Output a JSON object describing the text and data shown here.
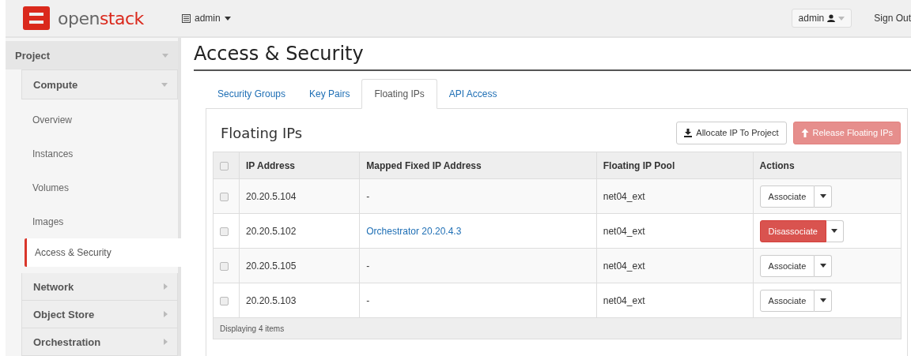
{
  "header": {
    "logo_parts": [
      "open",
      "stack"
    ],
    "project_menu": "admin",
    "user_menu": "admin",
    "sign_out": "Sign Out"
  },
  "sidebar": {
    "panel": {
      "label": "Project",
      "expanded": true
    },
    "groups": [
      {
        "label": "Compute",
        "expanded": true,
        "items": [
          {
            "label": "Overview",
            "selected": false
          },
          {
            "label": "Instances",
            "selected": false
          },
          {
            "label": "Volumes",
            "selected": false
          },
          {
            "label": "Images",
            "selected": false
          },
          {
            "label": "Access & Security",
            "selected": true
          }
        ]
      },
      {
        "label": "Network",
        "expanded": false
      },
      {
        "label": "Object Store",
        "expanded": false
      },
      {
        "label": "Orchestration",
        "expanded": false
      }
    ]
  },
  "page_title": "Access & Security",
  "tabs": [
    {
      "label": "Security Groups",
      "selected": false
    },
    {
      "label": "Key Pairs",
      "selected": false
    },
    {
      "label": "Floating IPs",
      "selected": true
    },
    {
      "label": "API Access",
      "selected": false
    }
  ],
  "table": {
    "title": "Floating IPs",
    "buttons": [
      {
        "label": "Allocate IP To Project",
        "kind": "default",
        "disabled": false
      },
      {
        "label": "Release Floating IPs",
        "kind": "danger",
        "disabled": true
      }
    ],
    "select_all": {
      "checked": false
    },
    "columns": [
      "IP Address",
      "Mapped Fixed IP Address",
      "Floating IP Pool",
      "Actions"
    ],
    "rows": [
      {
        "checked": false,
        "ip": "20.20.5.104",
        "mapped": {
          "text": "-",
          "link": false
        },
        "pool": "net04_ext",
        "action": {
          "label": "Associate",
          "kind": "default"
        }
      },
      {
        "checked": false,
        "ip": "20.20.5.102",
        "mapped": {
          "text": "Orchestrator 20.20.4.3",
          "link": true
        },
        "pool": "net04_ext",
        "action": {
          "label": "Disassociate",
          "kind": "danger"
        }
      },
      {
        "checked": false,
        "ip": "20.20.5.105",
        "mapped": {
          "text": "-",
          "link": false
        },
        "pool": "net04_ext",
        "action": {
          "label": "Associate",
          "kind": "default"
        }
      },
      {
        "checked": false,
        "ip": "20.20.5.103",
        "mapped": {
          "text": "-",
          "link": false
        },
        "pool": "net04_ext",
        "action": {
          "label": "Associate",
          "kind": "default"
        }
      }
    ],
    "footer": "Displaying 4 items"
  }
}
